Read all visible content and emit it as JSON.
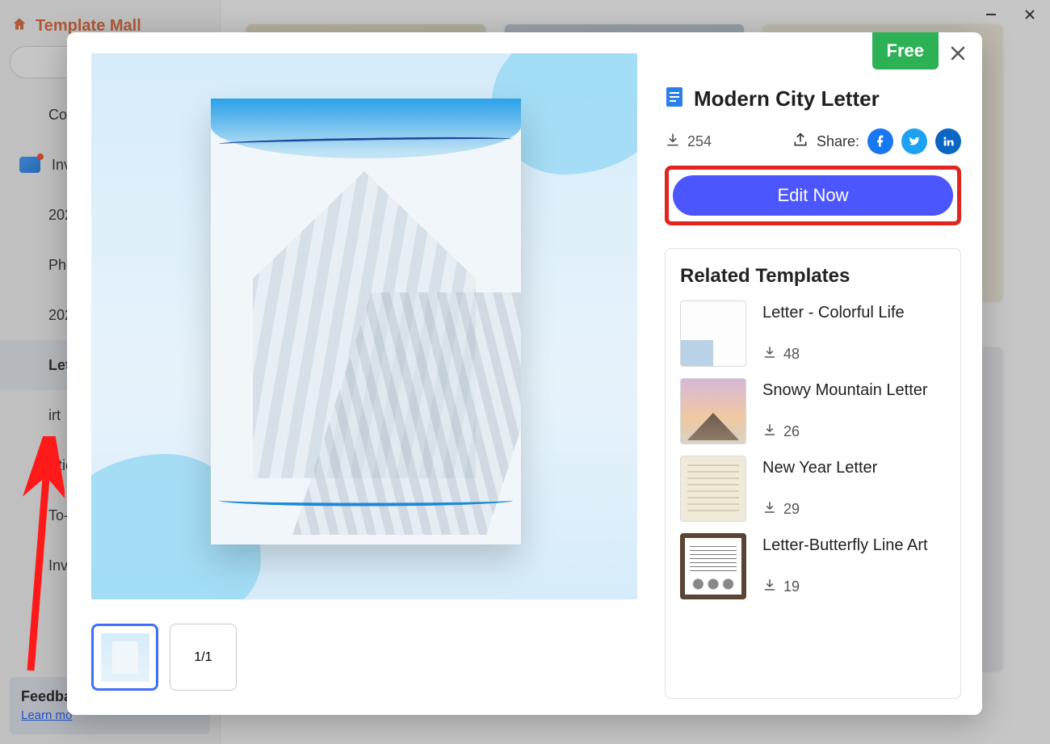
{
  "window": {
    "minimize_title": "Minimize",
    "close_title": "Close"
  },
  "sidebar": {
    "title": "Template Mall",
    "search_placeholder": "",
    "items": [
      {
        "label": "Co"
      },
      {
        "label": "Inv"
      },
      {
        "label": "202"
      },
      {
        "label": "Pho"
      },
      {
        "label": "202"
      },
      {
        "label": "Let"
      },
      {
        "label": "irt"
      },
      {
        "label": "Stic"
      },
      {
        "label": "To-"
      },
      {
        "label": "Inv"
      }
    ],
    "selected_index": 5,
    "feedback": {
      "title": "Feedba",
      "link": "Learn mo"
    }
  },
  "modal": {
    "free_badge": "Free",
    "title": "Modern City Letter",
    "downloads": "254",
    "share_label": "Share:",
    "edit_button": "Edit Now",
    "page_indicator": "1/1",
    "related_title": "Related Templates",
    "related": [
      {
        "name": "Letter - Colorful Life",
        "downloads": "48",
        "thumb": "colorful"
      },
      {
        "name": "Snowy Mountain Letter",
        "downloads": "26",
        "thumb": "snowy"
      },
      {
        "name": "New Year Letter",
        "downloads": "29",
        "thumb": "newyear"
      },
      {
        "name": "Letter-Butterfly Line Art",
        "downloads": "19",
        "thumb": "butterfly"
      }
    ]
  }
}
